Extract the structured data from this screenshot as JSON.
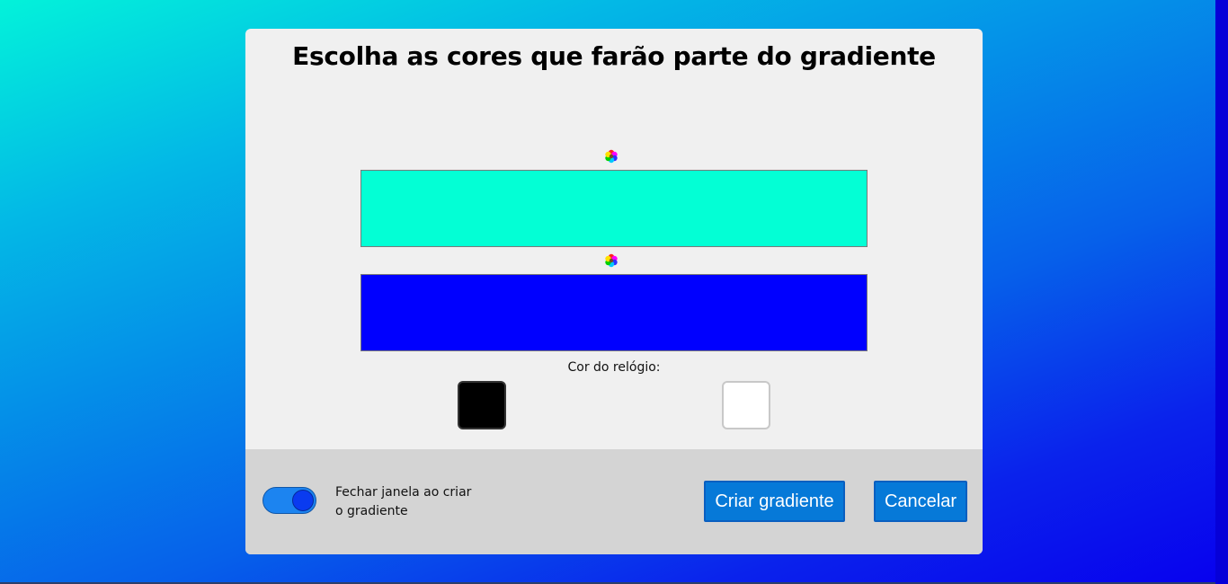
{
  "dialog": {
    "title": "Escolha as cores que farão parte do gradiente"
  },
  "gradient_colors": [
    {
      "color": "#03ffd5",
      "picker_icon": "color-wheel-icon"
    },
    {
      "color": "#0000ff",
      "picker_icon": "color-wheel-icon"
    }
  ],
  "clock": {
    "label": "Cor do relógio:",
    "options": [
      {
        "name": "black",
        "color": "#000000"
      },
      {
        "name": "white",
        "color": "#ffffff"
      }
    ]
  },
  "footer": {
    "toggle_on": true,
    "toggle_label_line1": "Fechar janela ao criar",
    "toggle_label_line2": "o gradiente",
    "create_label": "Criar gradiente",
    "cancel_label": "Cancelar"
  },
  "colors": {
    "accent": "#0679d8",
    "toggle_track": "#1c84f0",
    "toggle_knob": "#0a3bf0",
    "dialog_bg": "#f0f0f0",
    "footer_bg": "#d4d4d4"
  }
}
